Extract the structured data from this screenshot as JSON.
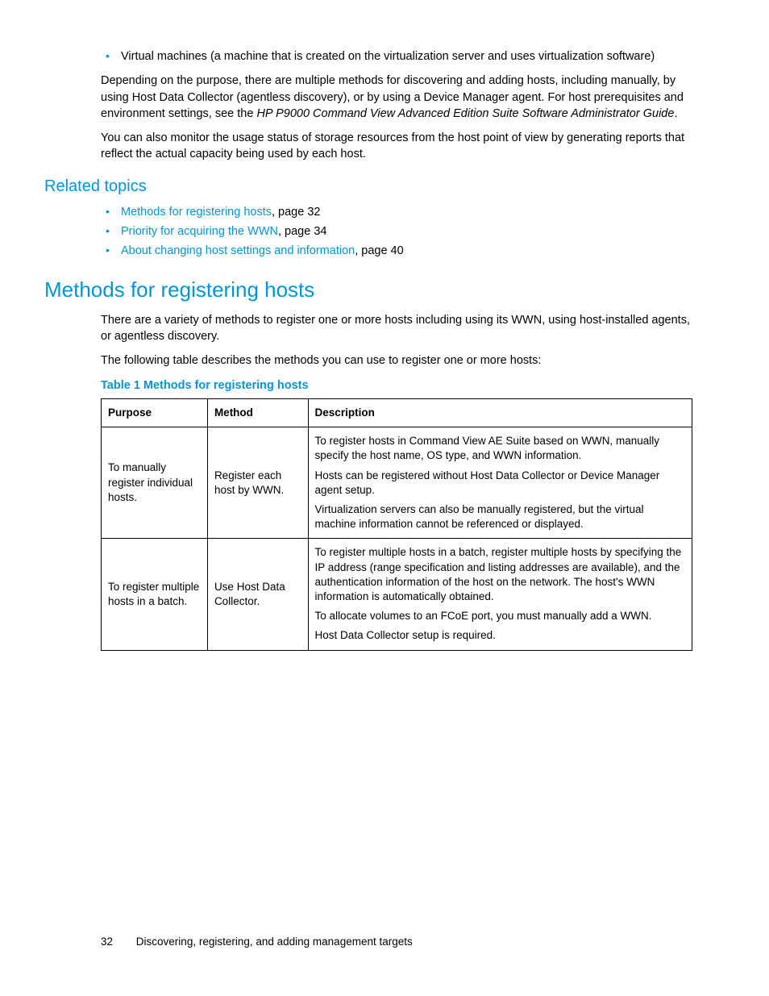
{
  "top_bullet": "Virtual machines (a machine that is created on the virtualization server and uses virtualization software)",
  "para1_a": "Depending on the purpose, there are multiple methods for discovering and adding hosts, including manually, by using Host Data Collector (agentless discovery), or by using a Device Manager agent. For host prerequisites and environment settings, see the ",
  "para1_italic": "HP P9000 Command View Advanced Edition Suite Software Administrator Guide",
  "para1_b": ".",
  "para2": "You can also monitor the usage status of storage resources from the host point of view by generating reports that reflect the actual capacity being used by each host.",
  "related_heading": "Related topics",
  "related": [
    {
      "link": "Methods for registering hosts",
      "suffix": ", page 32"
    },
    {
      "link": "Priority for acquiring the WWN",
      "suffix": ", page 34"
    },
    {
      "link": "About changing host settings and information",
      "suffix": ", page 40"
    }
  ],
  "section_heading": "Methods for registering hosts",
  "section_p1": "There are a variety of methods to register one or more hosts including using its WWN, using host-installed agents, or agentless discovery.",
  "section_p2": "The following table describes the methods you can use to register one or more hosts:",
  "table_caption": "Table 1 Methods for registering hosts",
  "table": {
    "headers": {
      "c1": "Purpose",
      "c2": "Method",
      "c3": "Description"
    },
    "rows": [
      {
        "c1": "To manually register individual hosts.",
        "c2": "Register each host by WWN.",
        "c3": [
          "To register hosts in Command View AE Suite based on WWN, manually specify the host name, OS type, and WWN information.",
          "Hosts can be registered without Host Data Collector or Device Manager agent setup.",
          "Virtualization servers can also be manually registered, but the virtual machine information cannot be referenced or displayed."
        ]
      },
      {
        "c1": "To register multiple hosts in a batch.",
        "c2": "Use Host Data Collector.",
        "c3": [
          "To register multiple hosts in a batch, register multiple hosts by specifying the IP address (range specification and listing addresses are available), and the authentication information of the host on the network. The host's WWN information is automatically obtained.",
          "To allocate volumes to an FCoE port, you must manually add a WWN.",
          "Host Data Collector setup is required."
        ]
      }
    ]
  },
  "footer": {
    "page": "32",
    "title": "Discovering, registering, and adding management targets"
  }
}
